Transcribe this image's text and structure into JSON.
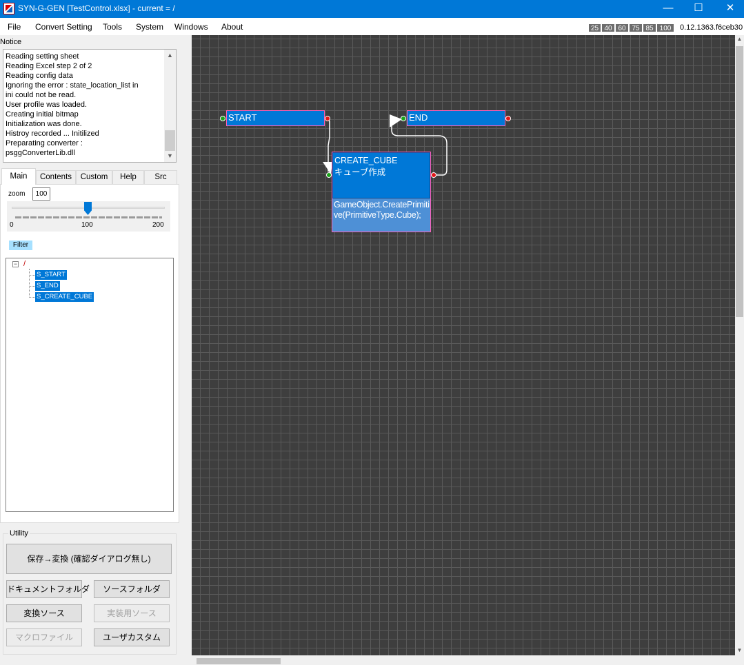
{
  "window": {
    "title": "SYN-G-GEN  [TestControl.xlsx] - current = /",
    "minimize_glyph": "—",
    "maximize_glyph": "☐",
    "close_glyph": "✕"
  },
  "menu": {
    "items": [
      "File",
      "Convert Setting",
      "Tools",
      "System",
      "Windows",
      "About"
    ],
    "zoom_presets": [
      "25",
      "40",
      "60",
      "75",
      "85",
      "100"
    ],
    "version": "0.12.1363.f6ceb30"
  },
  "notice": {
    "label": "Notice",
    "lines": [
      "Reading setting sheet",
      "Reading Excel step 2 of 2",
      "Reading config data",
      "Ignoring the error : state_location_list in",
      "ini could not be read.",
      "User profile was loaded.",
      "Creating initial bitmap",
      "Initialization was done.",
      "Histroy recorded ... Initilized",
      "Preparating converter :",
      "psggConverterLib.dll"
    ]
  },
  "tabs": [
    "Main",
    "Contents",
    "Custom",
    "Help",
    "Src"
  ],
  "main_tab": {
    "zoom_label": "zoom",
    "zoom_value": "100",
    "zoom_level": 100,
    "slider_min": "0",
    "slider_mid": "100",
    "slider_max": "200",
    "filter_label": "Filter",
    "tree_root": "/",
    "tree_items": [
      "S_START",
      "S_END",
      "S_CREATE_CUBE"
    ]
  },
  "utility": {
    "label": "Utility",
    "save_convert": "保存→変換 (確認ダイアログ無し)",
    "document_folder": "ドキュメントフォルダ",
    "source_folder": "ソースフォルダ",
    "convert_source": "変換ソース",
    "impl_source": "実装用ソース",
    "macro_file": "マクロファイル",
    "user_custom": "ユーザカスタム"
  },
  "graph": {
    "start_label": "START",
    "end_label": "END",
    "cube_name": "CREATE_CUBE",
    "cube_comment": "キューブ作成",
    "cube_code": "GameObject.CreatePrimitive(PrimitiveType.Cube);"
  },
  "colors": {
    "titlebar": "#0078d7",
    "state_fill": "#0078d7",
    "state_border": "#ff5fb8",
    "canvas_bg": "#3e3e3e",
    "grid": "#5a5a5a",
    "tree_selected": "#0078d7"
  }
}
